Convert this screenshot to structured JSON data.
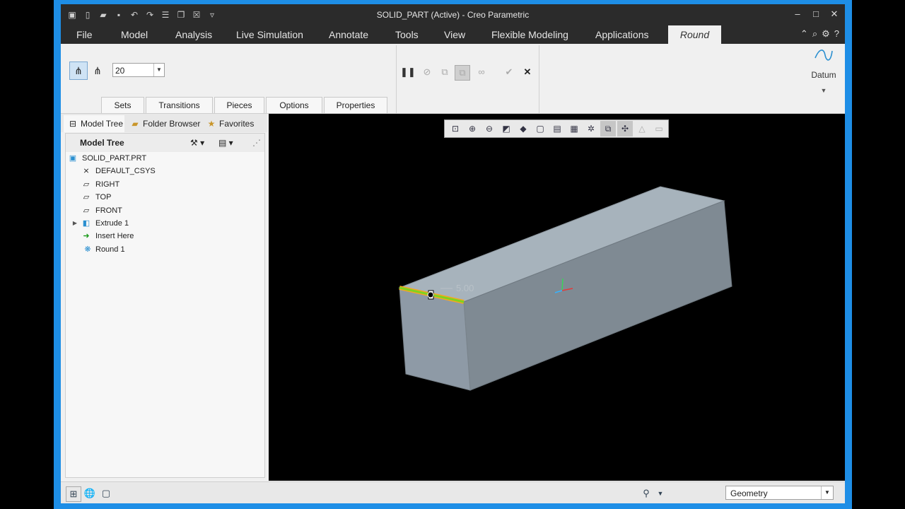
{
  "window": {
    "title": "SOLID_PART (Active) - Creo Parametric"
  },
  "menu": {
    "tabs": [
      "File",
      "Model",
      "Analysis",
      "Live Simulation",
      "Annotate",
      "Tools",
      "View",
      "Flexible Modeling",
      "Applications",
      "Round"
    ],
    "active_tab": "Round"
  },
  "ribbon": {
    "radius_value": "20",
    "subtabs": [
      "Sets",
      "Transitions",
      "Pieces",
      "Options",
      "Properties"
    ],
    "datum_label": "Datum"
  },
  "panel": {
    "tabs": [
      "Model Tree",
      "Folder Browser",
      "Favorites"
    ],
    "header": "Model Tree",
    "tree": [
      {
        "label": "SOLID_PART.PRT",
        "icon": "part-icon"
      },
      {
        "label": "DEFAULT_CSYS",
        "icon": "csys-icon"
      },
      {
        "label": "RIGHT",
        "icon": "datum-plane-icon"
      },
      {
        "label": "TOP",
        "icon": "datum-plane-icon"
      },
      {
        "label": "FRONT",
        "icon": "datum-plane-icon"
      },
      {
        "label": "Extrude 1",
        "icon": "extrude-icon"
      },
      {
        "label": "Insert Here",
        "icon": "insert-arrow-icon"
      },
      {
        "label": "Round 1",
        "icon": "round-icon"
      }
    ]
  },
  "viewport": {
    "dimension_label": "5.00"
  },
  "status": {
    "filter_value": "Geometry"
  },
  "colors": {
    "highlight_edge": "#7ed321",
    "edge_outline": "#f5a623",
    "part": "#8e9aa6"
  }
}
